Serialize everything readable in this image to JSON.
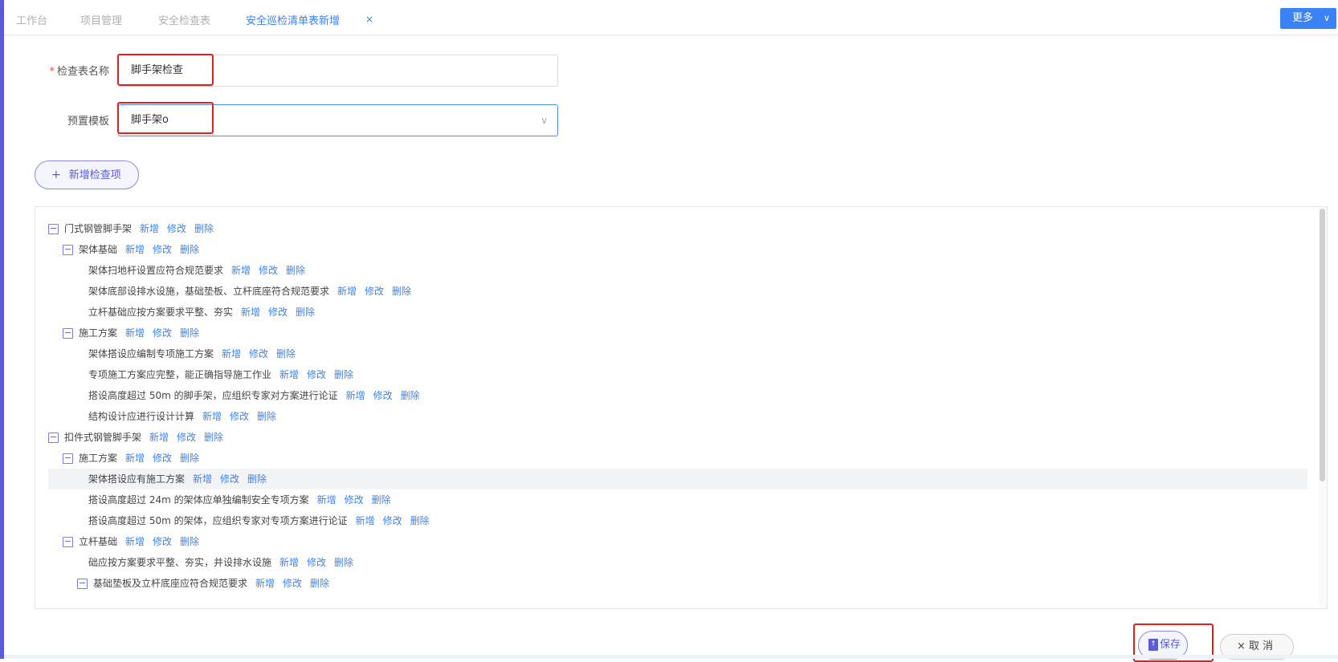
{
  "tabs": [
    {
      "label": "工作台"
    },
    {
      "label": "项目管理"
    },
    {
      "label": "安全检查表"
    },
    {
      "label": "安全巡检清单表新增"
    }
  ],
  "tab_close_glyph": "×",
  "more_button": {
    "label": "更多",
    "chevron": "∨"
  },
  "form": {
    "name_label": "检查表名称",
    "required_mark": "*",
    "name_value": "脚手架检查",
    "template_label": "预置模板",
    "template_value": "脚手架o",
    "template_chevron": "∨"
  },
  "add_item_button": {
    "icon": "+",
    "label": "新增检查项"
  },
  "ops": {
    "add": "新增",
    "edit": "修改",
    "delete": "删除"
  },
  "tree": [
    {
      "text": "门式钢管脚手架",
      "level": 0,
      "toggle": "−"
    },
    {
      "text": "架体基础",
      "level": 1,
      "toggle": "−"
    },
    {
      "text": "架体扫地杆设置应符合规范要求",
      "level": 2
    },
    {
      "text": "架体底部设排水设施，基础垫板、立杆底座符合规范要求",
      "level": 2
    },
    {
      "text": "立杆基础应按方案要求平整、夯实",
      "level": 2
    },
    {
      "text": "施工方案",
      "level": 1,
      "toggle": "−"
    },
    {
      "text": "架体搭设应编制专项施工方案",
      "level": 2
    },
    {
      "text": "专项施工方案应完整，能正确指导施工作业",
      "level": 2
    },
    {
      "text": "搭设高度超过 50m 的脚手架，应组织专家对方案进行论证",
      "level": 2
    },
    {
      "text": "结构设计应进行设计计算",
      "level": 2
    },
    {
      "text": "扣件式钢管脚手架",
      "level": 0,
      "toggle": "−"
    },
    {
      "text": "施工方案",
      "level": 1,
      "toggle": "−"
    },
    {
      "text": "架体搭设应有施工方案",
      "level": 2,
      "selected": true
    },
    {
      "text": "搭设高度超过 24m 的架体应单独编制安全专项方案",
      "level": 2
    },
    {
      "text": "搭设高度超过 50m 的架体，应组织专家对专项方案进行论证",
      "level": 2
    },
    {
      "text": "立杆基础",
      "level": 1,
      "toggle": "−"
    },
    {
      "text": "础应按方案要求平整、夯实，并设排水设施",
      "level": 2
    },
    {
      "text": "基础垫板及立杆底座应符合规范要求",
      "level": 2,
      "toggle": "−"
    }
  ],
  "save_button": {
    "label": "保存"
  },
  "cancel_button": {
    "icon": "×",
    "label": "取 消"
  },
  "colors": {
    "accent": "#3b82f6",
    "primary": "#5b5bd6",
    "highlight": "#e02020"
  }
}
